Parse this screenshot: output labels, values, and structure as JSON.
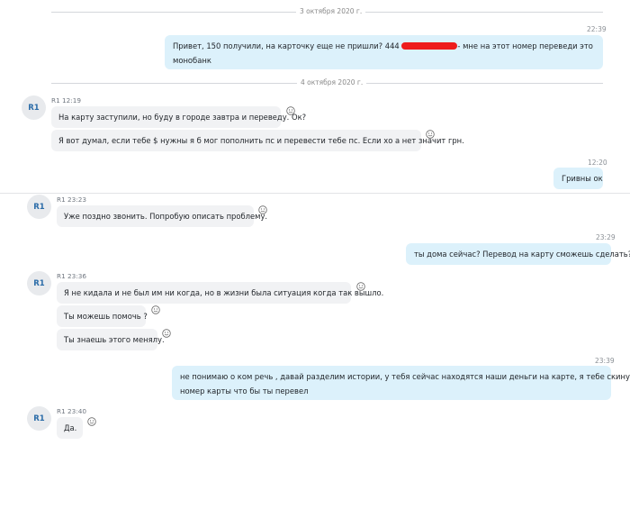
{
  "dates": {
    "d1": "3 октября 2020 г.",
    "d2": "4 октября 2020 г."
  },
  "outgoing": [
    {
      "time": "22:39",
      "line1": "Привет,  150 получили,  на карточку еще не пришли?  444 ",
      "line1_tail": "- мне на этот номер переведи это",
      "line2": "монобанк"
    },
    {
      "time": "12:20",
      "text": "Гривны ок"
    },
    {
      "time": "23:29",
      "text": "ты дома сейчас? Перевод на карту сможешь сделать?"
    },
    {
      "time": "23:39",
      "line1": "не понимаю о ком речь , давай разделим истории, у тебя сейчас находятся наши деньги на карте, я тебе скинул",
      "line2": "номер карты что бы ты перевел"
    }
  ],
  "incoming": {
    "avatar": "R1",
    "groups": [
      {
        "meta": "R1 12:19",
        "messages": [
          "На карту заступили, но буду в городе завтра и переведу. Ок?",
          "Я вот думал, если тебе $ нужны я б мог пополнить пс  и перевести тебе пс. Если хо а нет значит грн."
        ]
      },
      {
        "meta": "R1 23:23",
        "messages": [
          "Уже поздно звонить. Попробую описать проблему."
        ]
      },
      {
        "meta": "R1 23:36",
        "messages": [
          "Я не кидала и не был им ни когда, но в жизни была ситуация когда так вышло.",
          "Ты можешь помочь ?",
          "Ты знаешь этого менялу."
        ]
      },
      {
        "meta": "R1 23:40",
        "messages": [
          "Да."
        ]
      }
    ]
  },
  "icons": {
    "reaction": "smiley-icon",
    "redaction": "red-marker-redaction"
  },
  "colors": {
    "outgoing_bubble": "#dcf1fb",
    "incoming_bubble": "#f1f2f4",
    "avatar_text": "#2b6ca8",
    "redaction": "#ee1c1c"
  }
}
